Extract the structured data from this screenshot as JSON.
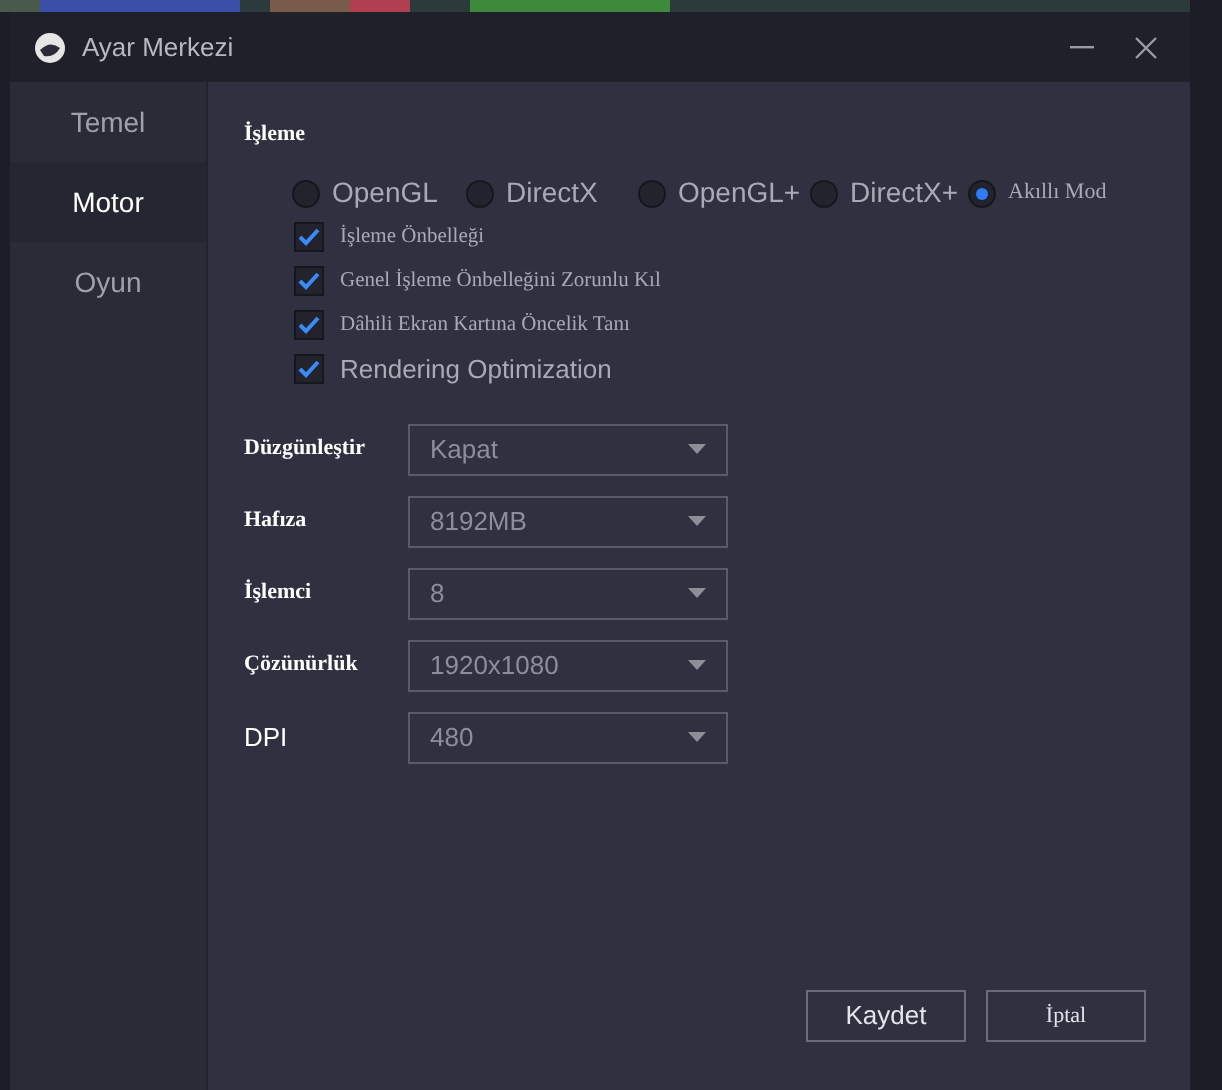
{
  "window": {
    "title": "Ayar Merkezi"
  },
  "sidebar": {
    "items": [
      {
        "label": "Temel",
        "selected": false
      },
      {
        "label": "Motor",
        "selected": true
      },
      {
        "label": "Oyun",
        "selected": false
      }
    ]
  },
  "rendering": {
    "title": "İşleme",
    "modes": [
      {
        "label": "OpenGL",
        "selected": false
      },
      {
        "label": "DirectX",
        "selected": false
      },
      {
        "label": "OpenGL+",
        "selected": false
      },
      {
        "label": "DirectX+",
        "selected": false
      },
      {
        "label": "Akıllı Mod",
        "selected": true
      }
    ],
    "options": [
      {
        "label": "İşleme Önbelleği",
        "checked": true
      },
      {
        "label": "Genel İşleme Önbelleğini Zorunlu Kıl",
        "checked": true
      },
      {
        "label": "Dâhili Ekran Kartına Öncelik Tanı",
        "checked": true
      },
      {
        "label": "Rendering Optimization",
        "checked": true
      }
    ]
  },
  "settings": [
    {
      "label": "Düzgünleştir",
      "value": "Kapat"
    },
    {
      "label": "Hafıza",
      "value": "8192MB"
    },
    {
      "label": "İşlemci",
      "value": "8"
    },
    {
      "label": "Çözünürlük",
      "value": "1920x1080"
    },
    {
      "label": "DPI",
      "value": "480"
    }
  ],
  "buttons": [
    "Kaydet",
    "İptal"
  ]
}
